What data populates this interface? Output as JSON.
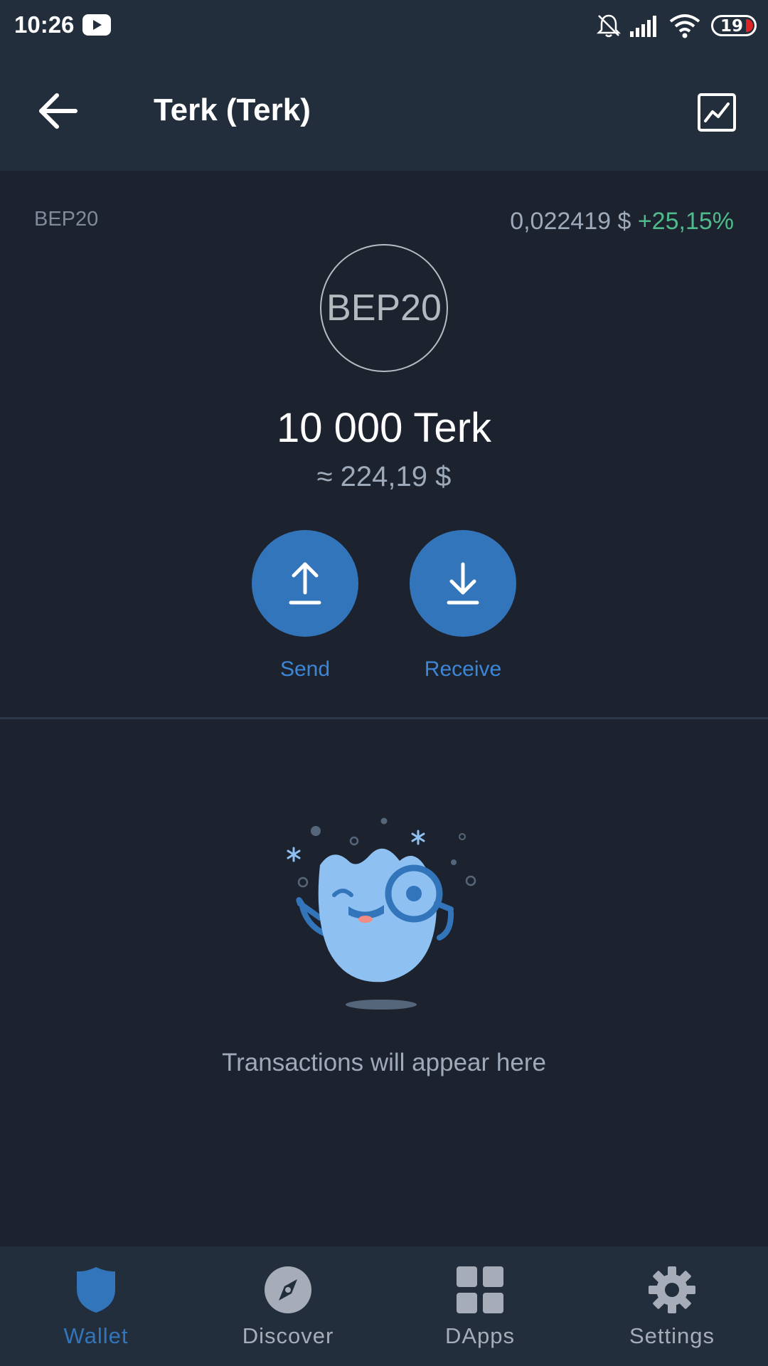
{
  "status_bar": {
    "time": "10:26",
    "battery": "19",
    "icons": [
      "youtube-icon",
      "bell-off-icon",
      "signal-icon",
      "wifi-icon",
      "battery-icon"
    ]
  },
  "toolbar": {
    "title": "Terk (Terk)",
    "back_icon": "arrow-left-icon",
    "chart_icon": "chart-icon"
  },
  "token": {
    "network": "BEP20",
    "price": "0,022419 $",
    "change": "+25,15%",
    "logo_text": "BEP20",
    "balance": "10 000 Terk",
    "fiat_balance": "≈ 224,19 $"
  },
  "actions": {
    "send_label": "Send",
    "receive_label": "Receive"
  },
  "empty_state": {
    "text": "Transactions will appear here"
  },
  "nav": {
    "items": [
      {
        "label": "Wallet",
        "icon": "shield-icon",
        "active": true
      },
      {
        "label": "Discover",
        "icon": "compass-icon",
        "active": false
      },
      {
        "label": "DApps",
        "icon": "grid-icon",
        "active": false
      },
      {
        "label": "Settings",
        "icon": "gear-icon",
        "active": false
      }
    ]
  },
  "colors": {
    "accent": "#3375bb",
    "positive": "#4fba8b",
    "background": "#1c232e",
    "bar": "#232e3c"
  }
}
